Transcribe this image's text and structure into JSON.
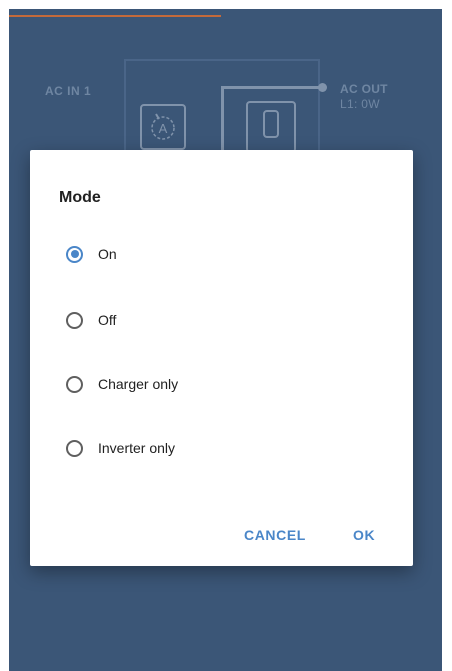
{
  "background": {
    "ac_in_label": "AC IN 1",
    "ac_out_label": "AC OUT",
    "ac_out_value": "L1: 0W",
    "dial_icon_letter": "A"
  },
  "dialog": {
    "title": "Mode",
    "options": [
      {
        "label": "On",
        "selected": true
      },
      {
        "label": "Off",
        "selected": false
      },
      {
        "label": "Charger only",
        "selected": false
      },
      {
        "label": "Inverter only",
        "selected": false
      }
    ],
    "cancel_label": "CANCEL",
    "ok_label": "OK"
  },
  "colors": {
    "background": "#3b5677",
    "accent": "#4a86c8",
    "progress": "#c46a3b"
  }
}
